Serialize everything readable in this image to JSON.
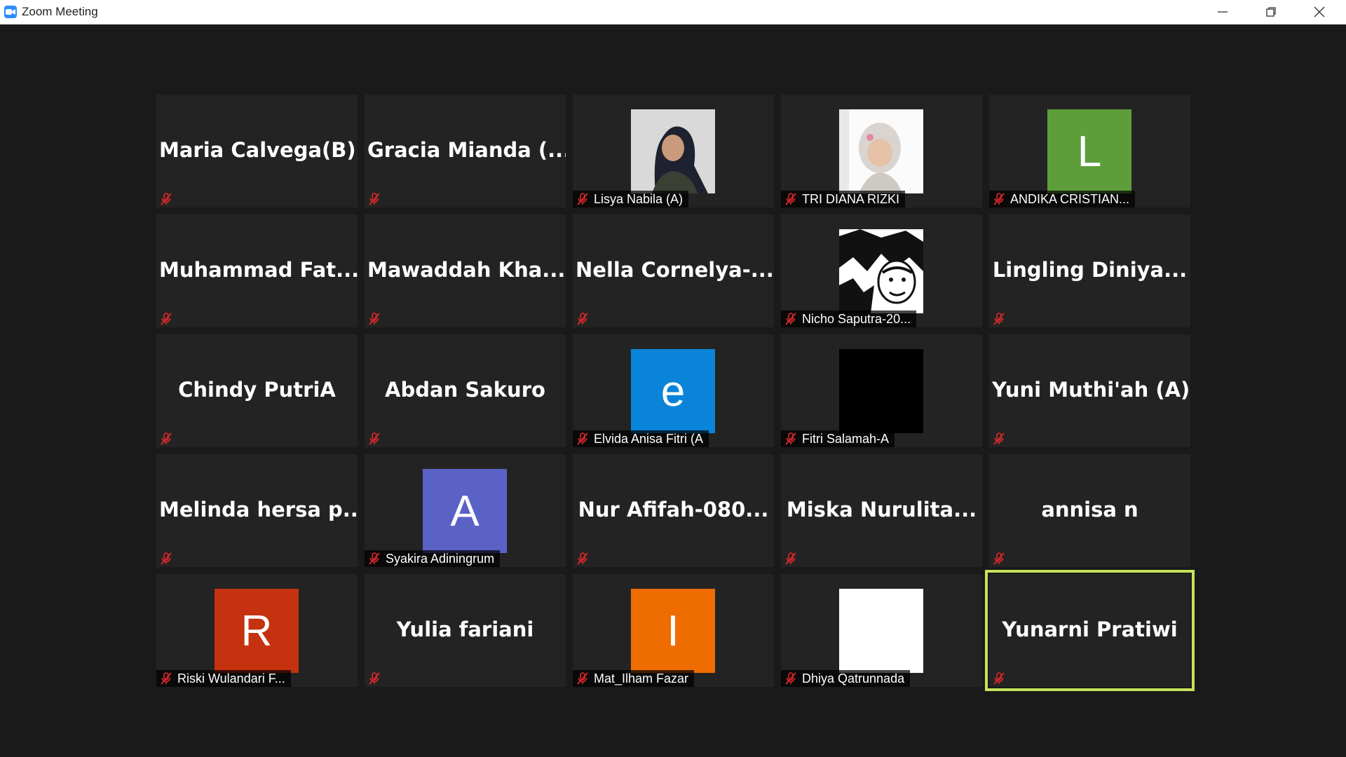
{
  "window": {
    "title": "Zoom Meeting",
    "app_icon": "zoom-camera-icon",
    "controls": [
      "minimize-icon",
      "restore-icon",
      "close-icon"
    ]
  },
  "colors": {
    "active_speaker_border": "#c5e25b",
    "tile_background": "#232323",
    "stage_background": "#1a1a1a",
    "muted_icon": "#e02828"
  },
  "participants": [
    {
      "display": "Maria Calvega(B)",
      "label": "",
      "muted": true
    },
    {
      "display": "Gracia  Mianda  (...",
      "label": "",
      "muted": true
    },
    {
      "display": "",
      "label": "Lisya Nabila (A)",
      "muted": true,
      "video": "photo"
    },
    {
      "display": "",
      "label": "TRI DIANA RIZKI",
      "muted": true,
      "video": "photo"
    },
    {
      "display": "L",
      "label": "ANDIKA CRISTIAN...",
      "muted": true,
      "avatar_color": "#5d9e3a"
    },
    {
      "display": "Muhammad  Fat...",
      "label": "",
      "muted": true
    },
    {
      "display": "Mawaddah  Kha...",
      "label": "",
      "muted": true
    },
    {
      "display": "Nella  Cornelya-...",
      "label": "",
      "muted": true
    },
    {
      "display": "",
      "label": "Nicho Saputra-20...",
      "muted": true,
      "video": "photo"
    },
    {
      "display": "Lingling  Diniya...",
      "label": "",
      "muted": true
    },
    {
      "display": "Chindy PutriA",
      "label": "",
      "muted": true
    },
    {
      "display": "Abdan Sakuro",
      "label": "",
      "muted": true
    },
    {
      "display": "e",
      "label": "Elvida Anisa Fitri (A",
      "muted": true,
      "avatar_color": "#0a84d8"
    },
    {
      "display": "",
      "label": "Fitri Salamah-A",
      "muted": true,
      "video": "black"
    },
    {
      "display": "Yuni Muthi'ah (A)",
      "label": "",
      "muted": true
    },
    {
      "display": "Melinda  hersa  p...",
      "label": "",
      "muted": true
    },
    {
      "display": "A",
      "label": "Syakira Adiningrum",
      "muted": true,
      "avatar_color": "#5b62c6"
    },
    {
      "display": "Nur  Afifah-080...",
      "label": "",
      "muted": true
    },
    {
      "display": "Miska  Nurulita...",
      "label": "",
      "muted": true
    },
    {
      "display": "annisa n",
      "label": "",
      "muted": true
    },
    {
      "display": "R",
      "label": "Riski Wulandari F...",
      "muted": true,
      "avatar_color": "#c4320f"
    },
    {
      "display": "Yulia fariani",
      "label": "",
      "muted": true
    },
    {
      "display": "I",
      "label": "Mat_Ilham Fazar",
      "muted": true,
      "avatar_color": "#ef6c00"
    },
    {
      "display": "",
      "label": "Dhiya Qatrunnada",
      "muted": true,
      "video": "white"
    },
    {
      "display": "Yunarni Pratiwi",
      "label": "",
      "muted": true,
      "active_speaker": true
    }
  ]
}
